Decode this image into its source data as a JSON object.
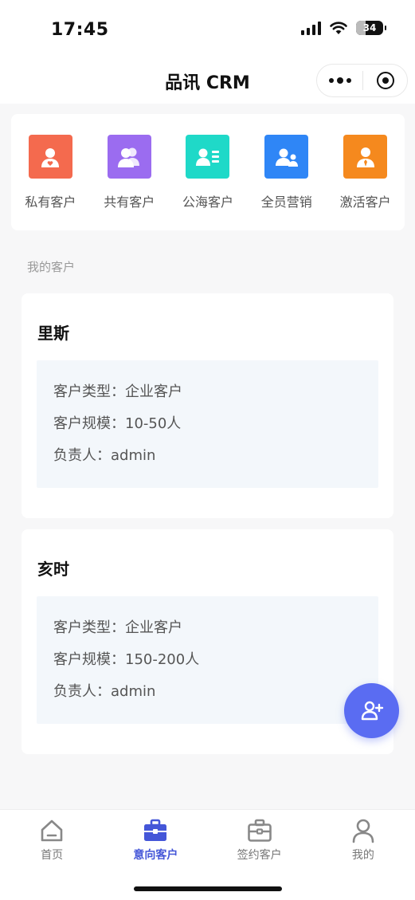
{
  "status_bar": {
    "time": "17:45",
    "battery": "34"
  },
  "nav": {
    "title": "品讯 CRM"
  },
  "quick_actions": [
    {
      "label": "私有客户",
      "color": "#f46a4e",
      "icon": "person-heart-icon"
    },
    {
      "label": "共有客户",
      "color": "#9b6cf0",
      "icon": "people-icon"
    },
    {
      "label": "公海客户",
      "color": "#1fd9c8",
      "icon": "contact-list-icon"
    },
    {
      "label": "全员营销",
      "color": "#2f86f6",
      "icon": "team-icon"
    },
    {
      "label": "激活客户",
      "color": "#f5891e",
      "icon": "person-tie-icon"
    }
  ],
  "section": {
    "title": "我的客户"
  },
  "customers": [
    {
      "name": "里斯",
      "type": "客户类型：企业客户",
      "scale": "客户规模：10-50人",
      "owner": "负责人：admin"
    },
    {
      "name": "亥时",
      "type": "客户类型：企业客户",
      "scale": "客户规模：150-200人",
      "owner": "负责人：admin"
    }
  ],
  "tabbar": [
    {
      "label": "首页",
      "icon": "home-icon"
    },
    {
      "label": "意向客户",
      "icon": "briefcase-icon",
      "active": true
    },
    {
      "label": "签约客户",
      "icon": "case-icon"
    },
    {
      "label": "我的",
      "icon": "user-icon"
    }
  ],
  "colors": {
    "accent": "#4456d8",
    "fab": "#5a6cf2",
    "info_bg": "#f3f7fb"
  }
}
